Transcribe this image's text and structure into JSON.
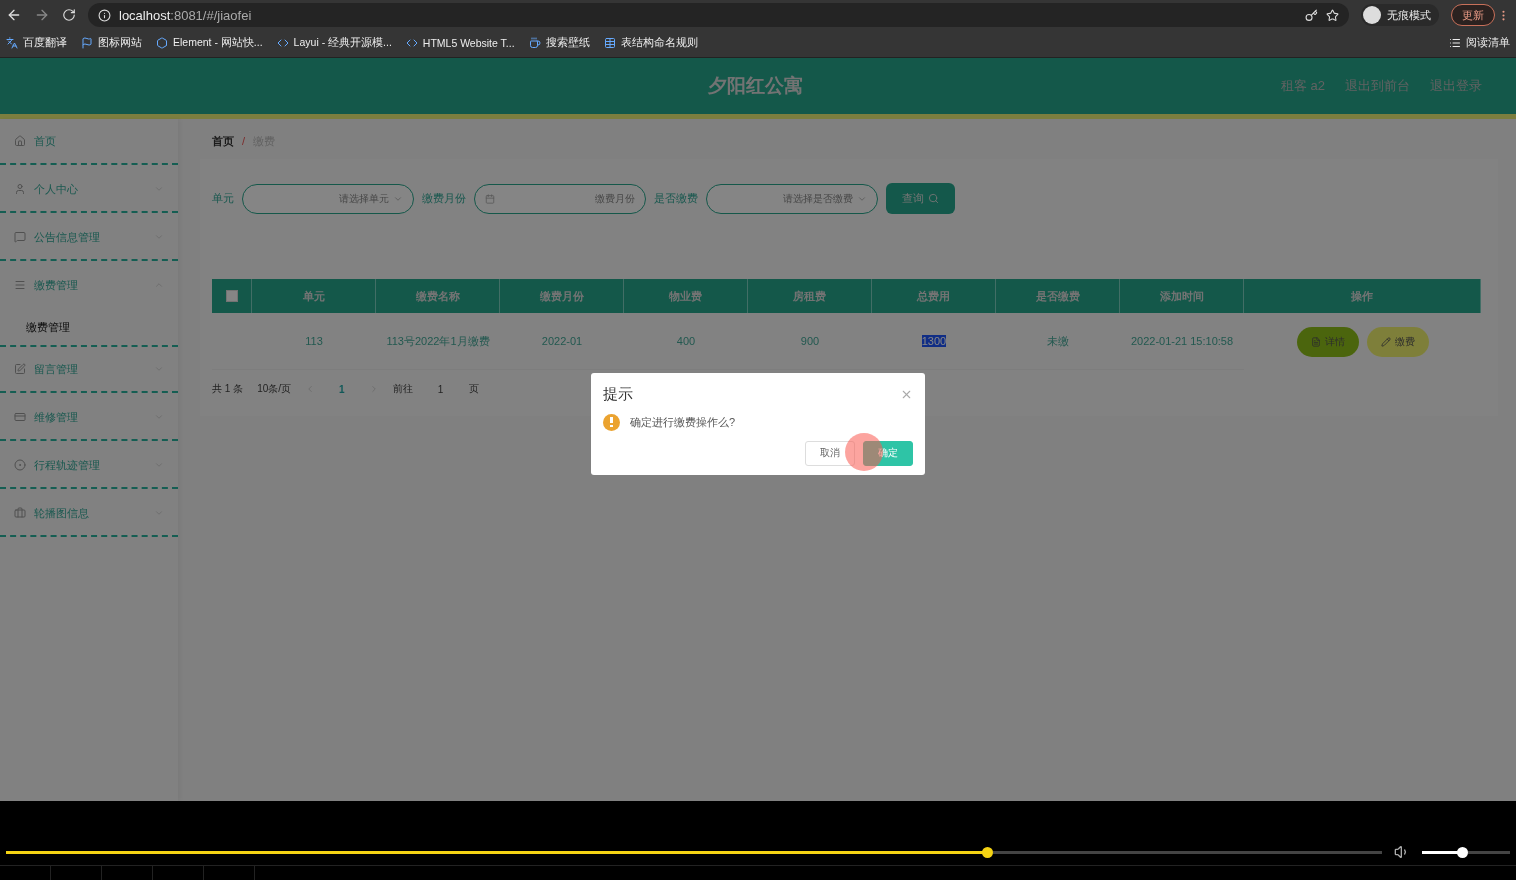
{
  "browser": {
    "url_host": "localhost",
    "url_rest": ":8081/#/jiaofei",
    "profile": "无痕模式",
    "update_button": "更新",
    "bookmarks": [
      "百度翻译",
      "图标网站",
      "Element - 网站快...",
      "Layui - 经典开源模...",
      "HTML5 Website T...",
      "搜索壁纸",
      "表结构命名规则"
    ],
    "reading_list": "阅读清单"
  },
  "header": {
    "title": "夕阳红公寓",
    "links": [
      "租客 a2",
      "退出到前台",
      "退出登录"
    ]
  },
  "sidebar": {
    "items": [
      {
        "label": "首页",
        "kind": "link"
      },
      {
        "label": "个人中心",
        "kind": "menu"
      },
      {
        "label": "公告信息管理",
        "kind": "menu"
      },
      {
        "label": "缴费管理",
        "kind": "menu",
        "children": [
          {
            "label": "缴费管理",
            "selected": true
          }
        ]
      },
      {
        "label": "留言管理",
        "kind": "menu"
      },
      {
        "label": "维修管理",
        "kind": "menu"
      },
      {
        "label": "行程轨迹管理",
        "kind": "menu"
      },
      {
        "label": "轮播图信息",
        "kind": "menu"
      }
    ]
  },
  "breadcrumb": {
    "items": [
      "首页",
      "缴费"
    ],
    "separator": "/"
  },
  "filters": [
    {
      "label": "单元",
      "placeholder": "请选择单元",
      "kind": "select"
    },
    {
      "label": "缴费月份",
      "placeholder": "缴费月份",
      "kind": "date"
    },
    {
      "label": "是否缴费",
      "placeholder": "请选择是否缴费",
      "kind": "select"
    }
  ],
  "search_button": "查询",
  "table": {
    "select_all_checked": false,
    "columns": [
      "单元",
      "缴费名称",
      "缴费月份",
      "物业费",
      "房租费",
      "总费用",
      "是否缴费",
      "添加时间",
      "操作"
    ],
    "rows": [
      {
        "cells": [
          {
            "text": "113",
            "highlighted": false
          },
          {
            "text": "113号2022年1月缴费",
            "highlighted": false
          },
          {
            "text": "2022-01",
            "highlighted": false
          },
          {
            "text": "400",
            "highlighted": false
          },
          {
            "text": "900",
            "highlighted": false
          },
          {
            "text": "1300",
            "highlighted": true
          },
          {
            "text": "未缴",
            "highlighted": false
          },
          {
            "text": "2022-01-21 15:10:58",
            "highlighted": false
          }
        ],
        "actions": [
          {
            "label": "详情",
            "kind": "detail"
          },
          {
            "label": "缴费",
            "kind": "pay"
          }
        ]
      }
    ]
  },
  "pagination": {
    "total": "共 1 条",
    "page_size": "10条/页",
    "pages": [
      {
        "label": "1",
        "selected": true
      }
    ],
    "goto_label": "前往",
    "goto_value": "1",
    "goto_suffix": "页"
  },
  "dialog": {
    "title": "提示",
    "message": "确定进行缴费操作么?",
    "buttons": [
      {
        "label": "取消",
        "kind": "cancel"
      },
      {
        "label": "确定",
        "kind": "primary"
      }
    ]
  },
  "player": {
    "progress": {
      "level": 0.713
    },
    "volume": {
      "level": 0.46
    }
  }
}
